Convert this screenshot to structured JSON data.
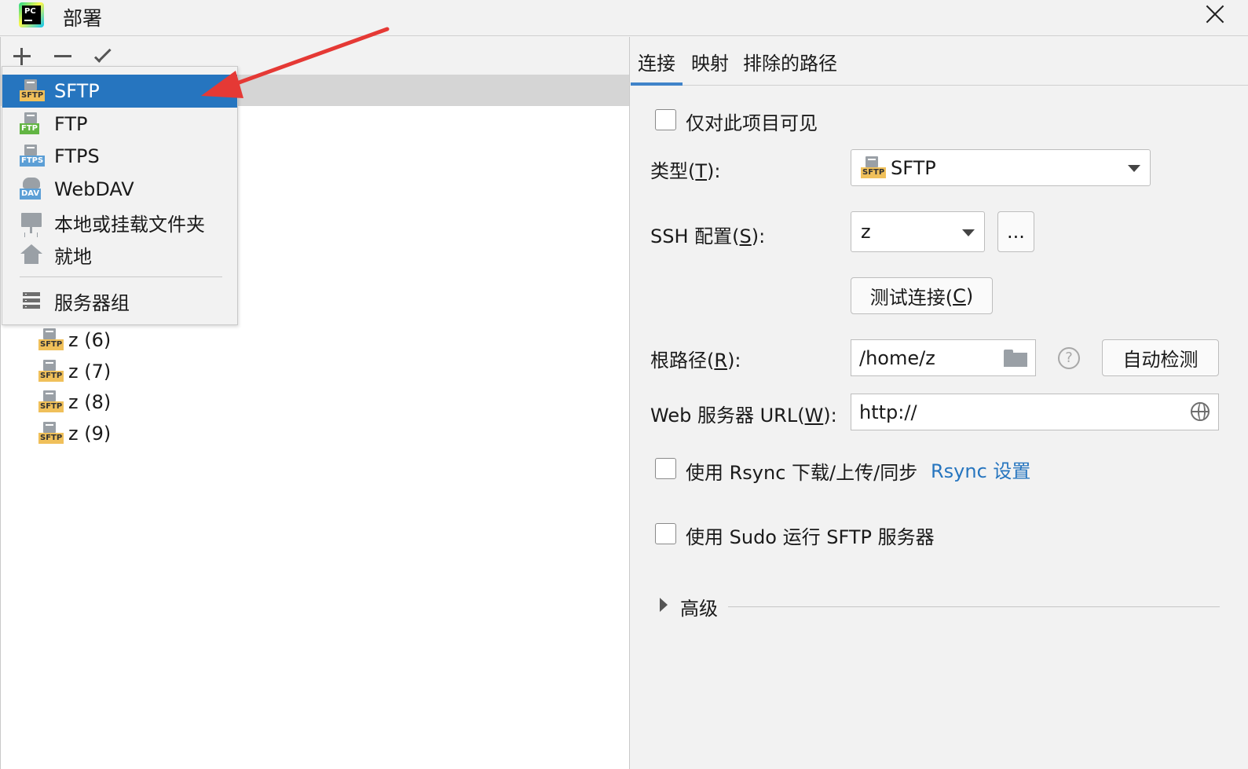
{
  "window": {
    "title": "部署",
    "app_icon": "pycharm-icon"
  },
  "left_toolbar": {
    "add": "plus-icon",
    "remove": "minus-icon",
    "apply": "check-icon"
  },
  "popup": {
    "items": [
      {
        "label": "SFTP",
        "icon": "sftp-icon",
        "tag": "SFTP",
        "active": true
      },
      {
        "label": "FTP",
        "icon": "ftp-icon",
        "tag": "FTP"
      },
      {
        "label": "FTPS",
        "icon": "ftps-icon",
        "tag": "FTPS"
      },
      {
        "label": "WebDAV",
        "icon": "webdav-icon",
        "tag": "DAV"
      },
      {
        "label": "本地或挂载文件夹",
        "icon": "mounted-folder-icon"
      },
      {
        "label": "就地",
        "icon": "home-icon"
      }
    ],
    "group_item": {
      "label": "服务器组",
      "icon": "server-group-icon"
    }
  },
  "tree_items": [
    {
      "label": "z (6)",
      "tag": "SFTP"
    },
    {
      "label": "z (7)",
      "tag": "SFTP"
    },
    {
      "label": "z (8)",
      "tag": "SFTP"
    },
    {
      "label": "z (9)",
      "tag": "SFTP"
    }
  ],
  "tabs": [
    "连接",
    "映射",
    "排除的路径"
  ],
  "form": {
    "visible_only_project": "仅对此项目可见",
    "type_label_pre": "类型(",
    "type_label_key": "T",
    "type_label_post": "):",
    "type_value": "SFTP",
    "type_tag": "SFTP",
    "ssh_label_pre": "SSH 配置(",
    "ssh_label_key": "S",
    "ssh_label_post": "):",
    "ssh_value": "z",
    "ssh_more": "...",
    "test_conn_pre": "测试连接(",
    "test_conn_key": "C",
    "test_conn_post": ")",
    "root_label_pre": "根路径(",
    "root_label_key": "R",
    "root_label_post": "):",
    "root_value": "/home/z",
    "help": "?",
    "autodetect": "自动检测",
    "web_label_pre": "Web 服务器 URL(",
    "web_label_key": "W",
    "web_label_post": "):",
    "web_value": "http://",
    "rsync_label": "使用 Rsync 下载/上传/同步",
    "rsync_link": "Rsync 设置",
    "sudo_label": "使用 Sudo 运行 SFTP 服务器",
    "advanced": "高级"
  },
  "colors": {
    "accent": "#2675bf",
    "selection": "#d5d5d5",
    "annotation_arrow": "#e53935"
  }
}
